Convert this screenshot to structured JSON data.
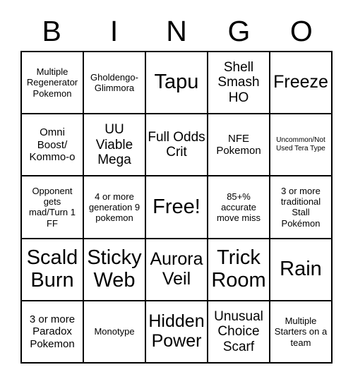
{
  "card": {
    "title": "BINGO",
    "header_letters": [
      "B",
      "I",
      "N",
      "G",
      "O"
    ],
    "free_space_label": "Free!",
    "colors": {
      "background": "#ffffff",
      "text": "#000000",
      "grid_line": "#000000"
    },
    "rows": [
      [
        {
          "text": "Multiple Regenerator Pokemon",
          "size": "sm"
        },
        {
          "text": "Gholdengo-Glimmora",
          "size": "sm"
        },
        {
          "text": "Tapu",
          "size": "xxl"
        },
        {
          "text": "Shell Smash HO",
          "size": "lg"
        },
        {
          "text": "Freeze",
          "size": "xl"
        }
      ],
      [
        {
          "text": "Omni Boost/ Kommo-o",
          "size": "md"
        },
        {
          "text": "UU Viable Mega",
          "size": "lg"
        },
        {
          "text": "Full Odds Crit",
          "size": "lg"
        },
        {
          "text": "NFE Pokemon",
          "size": "md"
        },
        {
          "text": "Uncommon/Not Used Tera Type",
          "size": "xs"
        }
      ],
      [
        {
          "text": "Opponent gets mad/Turn 1 FF",
          "size": "sm"
        },
        {
          "text": "4 or more generation 9 pokemon",
          "size": "sm"
        },
        {
          "text": "Free!",
          "size": "xxl"
        },
        {
          "text": "85+% accurate move miss",
          "size": "sm"
        },
        {
          "text": "3 or more traditional Stall Pokémon",
          "size": "sm"
        }
      ],
      [
        {
          "text": "Scald Burn",
          "size": "xxl"
        },
        {
          "text": "Sticky Web",
          "size": "xxl"
        },
        {
          "text": "Aurora Veil",
          "size": "xl"
        },
        {
          "text": "Trick Room",
          "size": "xxl"
        },
        {
          "text": "Rain",
          "size": "xxl"
        }
      ],
      [
        {
          "text": "3 or more Paradox Pokemon",
          "size": "md"
        },
        {
          "text": "Monotype",
          "size": "sm"
        },
        {
          "text": "Hidden Power",
          "size": "xl"
        },
        {
          "text": "Unusual Choice Scarf",
          "size": "lg"
        },
        {
          "text": "Multiple Starters on a team",
          "size": "sm"
        }
      ]
    ]
  }
}
